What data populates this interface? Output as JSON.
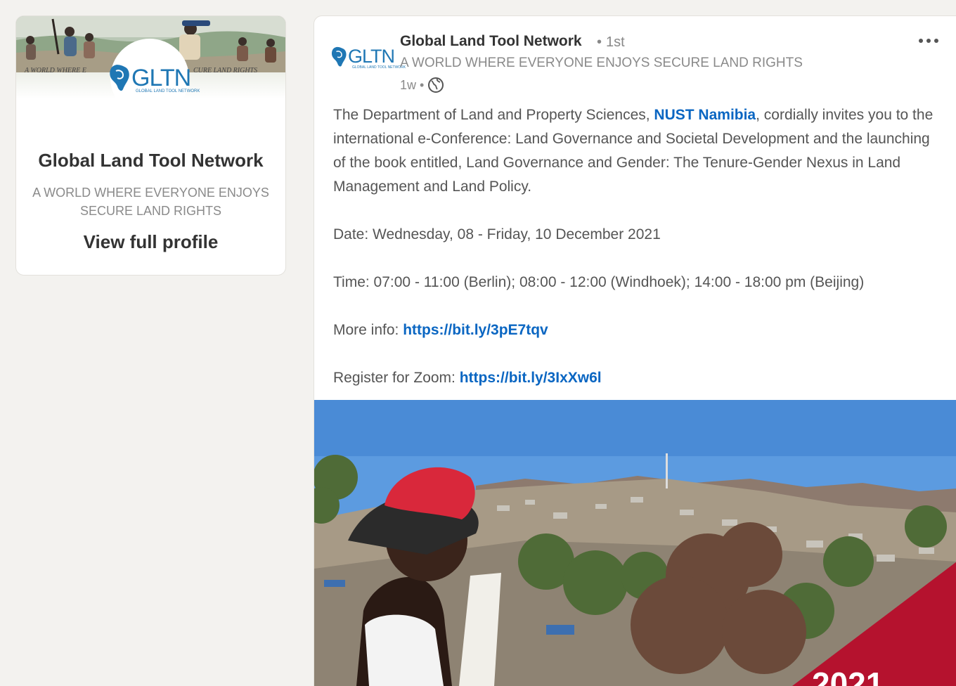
{
  "profile_card": {
    "banner_tagline_left": "A WORLD WHERE E",
    "banner_tagline_right": "CURE LAND RIGHTS",
    "logo_text": "GLTN",
    "logo_subtext": "GLOBAL LAND TOOL NETWORK",
    "name": "Global Land Tool Network",
    "tagline": "A WORLD WHERE EVERYONE ENJOYS SECURE LAND RIGHTS",
    "view_profile_label": "View full profile"
  },
  "post": {
    "author": {
      "logo_text": "GLTN",
      "logo_subtext": "GLOBAL LAND TOOL NETWORK",
      "name": "Global Land Tool Network",
      "degree": "1st",
      "headline": "A WORLD WHERE EVERYONE ENJOYS SECURE LAND RIGHTS",
      "time_ago": "1w"
    },
    "intro_before_mention": "The Department of Land and Property Sciences, ",
    "mention": "NUST Namibia",
    "intro_after_mention": ", cordially invites you to the international e-Conference: Land Governance and Societal Development and the launching of the book entitled, Land Governance and Gender: The Tenure-Gender Nexus in Land Management and Land Policy.",
    "date_line": "Date: Wednesday, 08 - Friday, 10 December 2021",
    "time_line": "Time: 07:00 - 11:00 (Berlin); 08:00 - 12:00 (Windhoek); 14:00 - 18:00 pm (Beijing)",
    "more_info_label": "More info: ",
    "more_info_link": "https://bit.ly/3pE7tqv",
    "register_label": "Register for Zoom: ",
    "register_link": "https://bit.ly/3IxXw6l",
    "image_corner_text": "2021"
  },
  "colors": {
    "page_background": "#f3f2ef",
    "link": "#0a66c2",
    "logo_blue": "#1f77b4",
    "accent_red": "#b5122e"
  },
  "icons": {
    "globe": "globe-icon",
    "more": "more-options-icon"
  }
}
